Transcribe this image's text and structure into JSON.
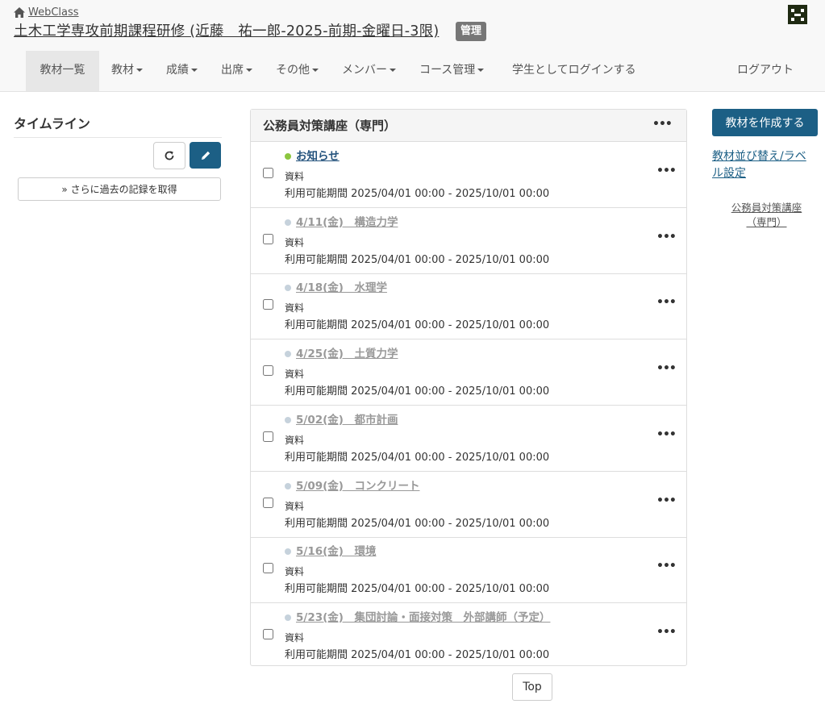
{
  "header": {
    "home_label": "WebClass",
    "course_title": "土木工学専攻前期課程研修 (近藤　祐一郎-2025-前期-金曜日-3限)",
    "admin_badge": "管理",
    "avatar_icon": "user-avatar-icon"
  },
  "nav": {
    "items": [
      {
        "label": "教材一覧",
        "dropdown": false,
        "active": true
      },
      {
        "label": "教材",
        "dropdown": true
      },
      {
        "label": "成績",
        "dropdown": true
      },
      {
        "label": "出席",
        "dropdown": true
      },
      {
        "label": "その他",
        "dropdown": true
      },
      {
        "label": "メンバー",
        "dropdown": true
      },
      {
        "label": "コース管理",
        "dropdown": true
      },
      {
        "label": "学生としてログインする",
        "dropdown": false
      }
    ],
    "logout": "ログアウト"
  },
  "timeline": {
    "title": "タイムライン",
    "refresh_icon": "refresh-icon",
    "edit_icon": "pencil-icon",
    "more_records": "» さらに過去の記録を取得"
  },
  "unit": {
    "title": "公務員対策講座（専門）",
    "menu_icon": "ellipsis-icon",
    "items": [
      {
        "title": "お知らせ",
        "type": "資料",
        "period": "利用可能期間 2025/04/01 00:00 - 2025/10/01 00:00",
        "status_color": "#8cc63f",
        "title_color": "#23527c"
      },
      {
        "title": "4/11(金)　構造力学",
        "type": "資料",
        "period": "利用可能期間 2025/04/01 00:00 - 2025/10/01 00:00",
        "status_color": "#c6d2dc",
        "title_color": "#999999"
      },
      {
        "title": "4/18(金)　水理学",
        "type": "資料",
        "period": "利用可能期間 2025/04/01 00:00 - 2025/10/01 00:00",
        "status_color": "#c6d2dc",
        "title_color": "#999999"
      },
      {
        "title": "4/25(金)　土質力学",
        "type": "資料",
        "period": "利用可能期間 2025/04/01 00:00 - 2025/10/01 00:00",
        "status_color": "#c6d2dc",
        "title_color": "#999999"
      },
      {
        "title": "5/02(金)　都市計画",
        "type": "資料",
        "period": "利用可能期間 2025/04/01 00:00 - 2025/10/01 00:00",
        "status_color": "#c6d2dc",
        "title_color": "#999999"
      },
      {
        "title": "5/09(金)　コンクリート",
        "type": "資料",
        "period": "利用可能期間 2025/04/01 00:00 - 2025/10/01 00:00",
        "status_color": "#c6d2dc",
        "title_color": "#999999"
      },
      {
        "title": "5/16(金)　環境",
        "type": "資料",
        "period": "利用可能期間 2025/04/01 00:00 - 2025/10/01 00:00",
        "status_color": "#c6d2dc",
        "title_color": "#999999"
      },
      {
        "title": "5/23(金)　集団討論・面接対策　外部講師（予定）",
        "type": "資料",
        "period": "利用可能期間 2025/04/01 00:00 - 2025/10/01 00:00",
        "status_color": "#c6d2dc",
        "title_color": "#999999"
      }
    ]
  },
  "top_button": "Top",
  "sidebar": {
    "create_button": "教材を作成する",
    "sort_link": "教材並び替え/ラベル設定",
    "unit_link": "公務員対策講座（専門）"
  },
  "colors": {
    "primary": "#1c5f85",
    "header_bg": "#f8f8f8"
  }
}
